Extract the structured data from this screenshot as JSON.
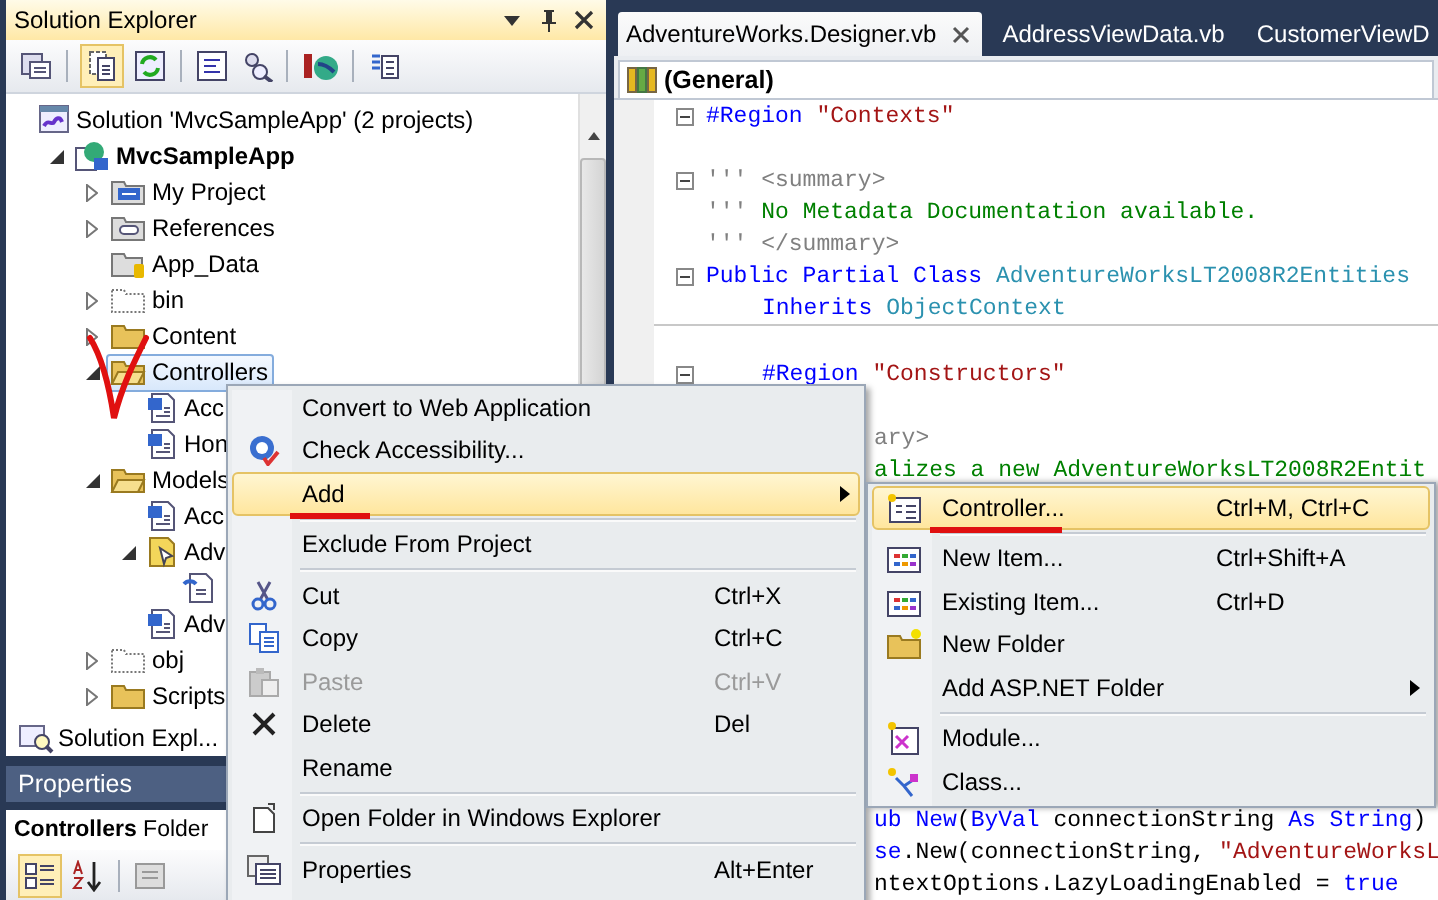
{
  "solution_explorer": {
    "title": "Solution Explorer",
    "tree": [
      {
        "label": "Solution 'MvcSampleApp' (2 projects)",
        "kind": "solution",
        "selected": false,
        "children": [
          {
            "label": "MvcSampleApp",
            "kind": "project",
            "expanded": true,
            "selected": false,
            "children": [
              {
                "label": "My Project",
                "kind": "myproject",
                "expanded": false,
                "selected": false
              },
              {
                "label": "References",
                "kind": "references",
                "expanded": false,
                "selected": false
              },
              {
                "label": "App_Data",
                "kind": "datafolder",
                "selected": false
              },
              {
                "label": "bin",
                "kind": "hiddenfolder",
                "expanded": false,
                "selected": false
              },
              {
                "label": "Content",
                "kind": "folder",
                "expanded": false,
                "selected": false
              },
              {
                "label": "Controllers",
                "kind": "folder",
                "expanded": true,
                "selected": true,
                "check_mark": true,
                "children": [
                  {
                    "label": "Acc",
                    "kind": "vbfile",
                    "selected": false
                  },
                  {
                    "label": "Hon",
                    "kind": "vbfile",
                    "selected": false
                  }
                ]
              },
              {
                "label": "Models",
                "kind": "folder",
                "expanded": true,
                "selected": false,
                "children": [
                  {
                    "label": "Acc",
                    "kind": "vbfile",
                    "selected": false
                  },
                  {
                    "label": "Adv",
                    "kind": "model",
                    "expanded": true,
                    "selected": false,
                    "children": [
                      {
                        "kind": "generated",
                        "selected": false
                      }
                    ]
                  },
                  {
                    "label": "Adv",
                    "kind": "vbfile",
                    "selected": false
                  }
                ]
              },
              {
                "label": "obj",
                "kind": "hiddenfolder",
                "expanded": false,
                "selected": false
              },
              {
                "label": "Scripts",
                "kind": "folder",
                "expanded": false,
                "selected": false
              }
            ]
          }
        ]
      }
    ],
    "bottom_tab": "Solution Expl..."
  },
  "properties": {
    "title": "Properties",
    "object_name": "Controllers",
    "object_type": "Folder"
  },
  "editor": {
    "tabs": [
      {
        "label": "AdventureWorks.Designer.vb",
        "selected": true
      },
      {
        "label": "AddressViewData.vb",
        "selected": false
      },
      {
        "label": "CustomerViewD",
        "selected": false
      }
    ],
    "member_dropdown": "(General)",
    "code_lines": [
      {
        "kind": "top",
        "collapsible": true,
        "segments": [
          {
            "kind": "keyword",
            "text": "#Region "
          },
          {
            "kind": "string",
            "text": "\"Contexts\""
          }
        ]
      },
      {
        "kind": "blank"
      },
      {
        "kind": "top",
        "collapsible": true,
        "segments": [
          {
            "kind": "doc",
            "text": "''' <summary>"
          }
        ]
      },
      {
        "kind": "top",
        "segments": [
          {
            "kind": "doc",
            "text": "''' "
          },
          {
            "kind": "comment",
            "text": "No Metadata Documentation available."
          }
        ]
      },
      {
        "kind": "top",
        "segments": [
          {
            "kind": "doc",
            "text": "''' </summary>"
          }
        ]
      },
      {
        "kind": "top",
        "collapsible": true,
        "segments": [
          {
            "kind": "keyword",
            "text": "Public Partial Class "
          },
          {
            "kind": "type",
            "text": "AdventureWorksLT2008R2Entities"
          }
        ]
      },
      {
        "kind": "member",
        "separator": true,
        "segments": [
          {
            "kind": "keyword",
            "text": "Inherits "
          },
          {
            "kind": "type",
            "text": "ObjectContext"
          }
        ]
      },
      {
        "kind": "blank"
      },
      {
        "kind": "member",
        "collapsible": true,
        "segments": [
          {
            "kind": "keyword",
            "text": "#Region "
          },
          {
            "kind": "string",
            "text": "\"Constructors\""
          }
        ]
      },
      {
        "kind": "blank"
      },
      {
        "kind": "tail",
        "segments": [
          {
            "kind": "doc",
            "text": "ary>"
          }
        ]
      },
      {
        "kind": "tail",
        "segments": [
          {
            "kind": "comment",
            "text": "alizes a new AdventureWorksLT2008R2Entit"
          }
        ]
      }
    ],
    "code_lines_lower": [
      {
        "kind": "tail",
        "segments": [
          {
            "kind": "keyword",
            "text": "ub New"
          },
          {
            "kind": "plain",
            "text": "("
          },
          {
            "kind": "keyword",
            "text": "ByVal"
          },
          {
            "kind": "plain",
            "text": " connectionString "
          },
          {
            "kind": "keyword",
            "text": "As String"
          },
          {
            "kind": "plain",
            "text": ")"
          }
        ]
      },
      {
        "kind": "tail",
        "segments": [
          {
            "kind": "keyword",
            "text": "se"
          },
          {
            "kind": "plain",
            "text": ".New(connectionString, "
          },
          {
            "kind": "string",
            "text": "\"AdventureWorksL"
          }
        ]
      },
      {
        "kind": "tail",
        "segments": [
          {
            "kind": "plain",
            "text": "ntextOptions.LazyLoadingEnabled = "
          },
          {
            "kind": "keyword",
            "text": "true"
          }
        ]
      }
    ]
  },
  "context_menu": {
    "items": [
      {
        "kind": "item",
        "label": "Convert to Web Application",
        "selected": false,
        "disabled": false
      },
      {
        "kind": "item",
        "label": "Check Accessibility...",
        "selected": false,
        "disabled": false
      },
      {
        "kind": "item",
        "label": "Add",
        "selected": true,
        "disabled": false,
        "submenu": true,
        "underlined": true
      },
      {
        "kind": "separator"
      },
      {
        "kind": "item",
        "label": "Exclude From Project",
        "selected": false,
        "disabled": false
      },
      {
        "kind": "separator"
      },
      {
        "kind": "item",
        "label": "Cut",
        "shortcut": "Ctrl+X",
        "selected": false,
        "disabled": false
      },
      {
        "kind": "item",
        "label": "Copy",
        "shortcut": "Ctrl+C",
        "selected": false,
        "disabled": false
      },
      {
        "kind": "item",
        "label": "Paste",
        "shortcut": "Ctrl+V",
        "selected": false,
        "disabled": true
      },
      {
        "kind": "item",
        "label": "Delete",
        "shortcut": "Del",
        "selected": false,
        "disabled": false
      },
      {
        "kind": "item",
        "label": "Rename",
        "selected": false,
        "disabled": false
      },
      {
        "kind": "separator"
      },
      {
        "kind": "item",
        "label": "Open Folder in Windows Explorer",
        "selected": false,
        "disabled": false
      },
      {
        "kind": "separator"
      },
      {
        "kind": "item",
        "label": "Properties",
        "shortcut": "Alt+Enter",
        "selected": false,
        "disabled": false
      }
    ]
  },
  "add_submenu": {
    "items": [
      {
        "kind": "item",
        "label": "Controller...",
        "shortcut": "Ctrl+M, Ctrl+C",
        "selected": true,
        "disabled": false,
        "underlined": true
      },
      {
        "kind": "separator"
      },
      {
        "kind": "item",
        "label": "New Item...",
        "shortcut": "Ctrl+Shift+A",
        "selected": false,
        "disabled": false
      },
      {
        "kind": "item",
        "label": "Existing Item...",
        "shortcut": "Ctrl+D",
        "selected": false,
        "disabled": false
      },
      {
        "kind": "item",
        "label": "New Folder",
        "selected": false,
        "disabled": false
      },
      {
        "kind": "item",
        "label": "Add ASP.NET Folder",
        "selected": false,
        "disabled": false,
        "submenu": true
      },
      {
        "kind": "separator"
      },
      {
        "kind": "item",
        "label": "Module...",
        "selected": false,
        "disabled": false
      },
      {
        "kind": "item",
        "label": "Class...",
        "selected": false,
        "disabled": false
      }
    ]
  }
}
